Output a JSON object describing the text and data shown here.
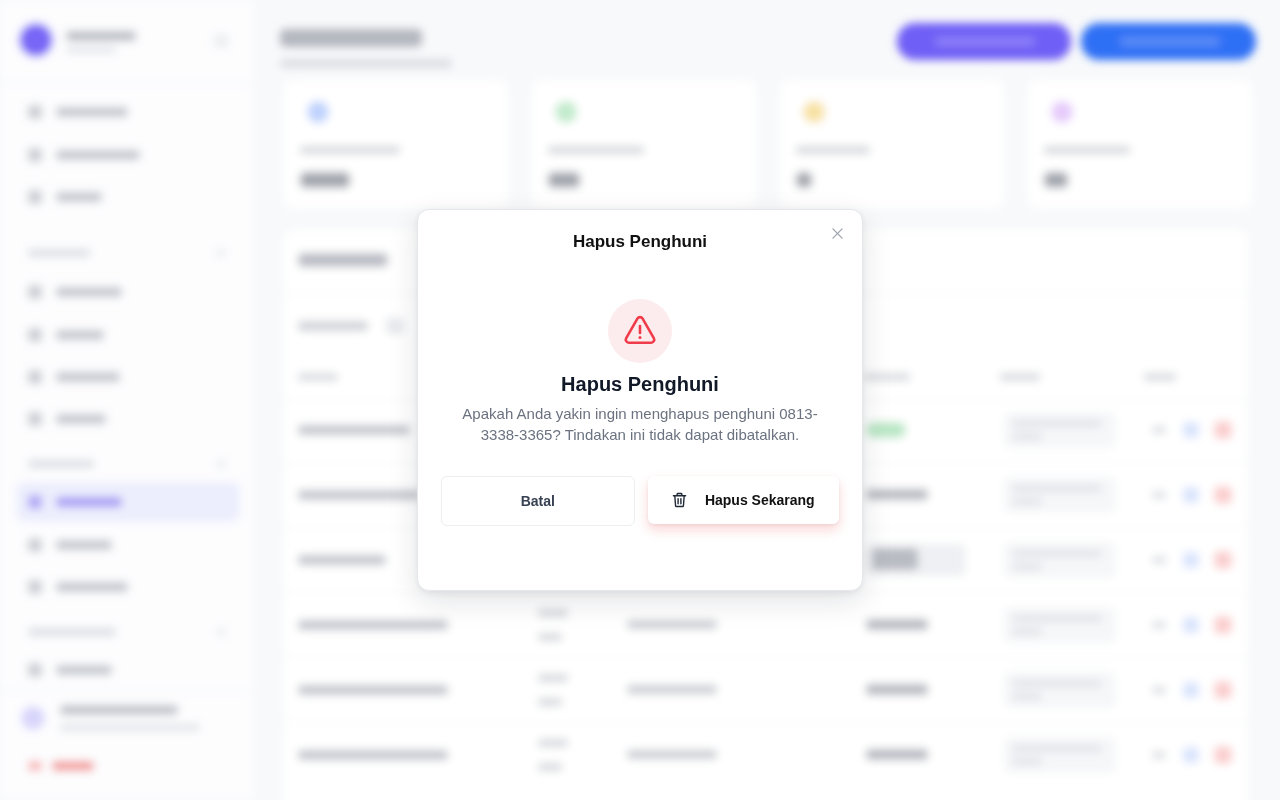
{
  "dialog": {
    "title": "Hapus Penghuni",
    "heading": "Hapus Penghuni",
    "message": "Apakah Anda yakin ingin menghapus penghuni 0813-3338-3365? Tindakan ini tidak dapat dibatalkan.",
    "buttons": [
      {
        "label": "Batal",
        "kind": "secondary"
      },
      {
        "label": "Hapus Sekarang",
        "kind": "danger"
      }
    ]
  }
}
